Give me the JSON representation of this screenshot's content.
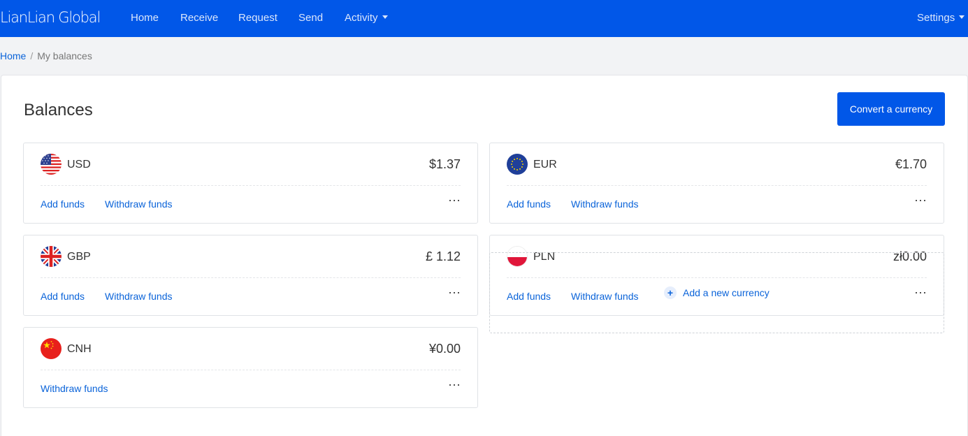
{
  "nav": {
    "logo": "LianLian Global",
    "home": "Home",
    "receive": "Receive",
    "request": "Request",
    "send": "Send",
    "activity": "Activity",
    "settings": "Settings"
  },
  "breadcrumb": {
    "home": "Home",
    "separator": "/",
    "current": "My balances"
  },
  "page": {
    "title": "Balances",
    "convert_button": "Convert a currency"
  },
  "balances": [
    {
      "code": "USD",
      "amount": "$1.37",
      "flag_icon": "us-flag-icon",
      "add_label": "Add funds",
      "withdraw_label": "Withdraw funds",
      "more": "···"
    },
    {
      "code": "EUR",
      "amount": "€1.70",
      "flag_icon": "eu-flag-icon",
      "add_label": "Add funds",
      "withdraw_label": "Withdraw funds",
      "more": "···"
    },
    {
      "code": "GBP",
      "amount": "£ 1.12",
      "flag_icon": "uk-flag-icon",
      "add_label": "Add funds",
      "withdraw_label": "Withdraw funds",
      "more": "···"
    },
    {
      "code": "PLN",
      "amount": "zł0.00",
      "flag_icon": "pl-flag-icon",
      "add_label": "Add funds",
      "withdraw_label": "Withdraw funds",
      "more": "···"
    },
    {
      "code": "CNH",
      "amount": "¥0.00",
      "flag_icon": "cn-flag-icon",
      "withdraw_label": "Withdraw funds",
      "more": "···"
    }
  ],
  "add_currency": {
    "icon": "plus-circle-icon",
    "label": "Add a new currency"
  },
  "colors": {
    "brand": "#0157e8",
    "link": "#0a63d9"
  }
}
